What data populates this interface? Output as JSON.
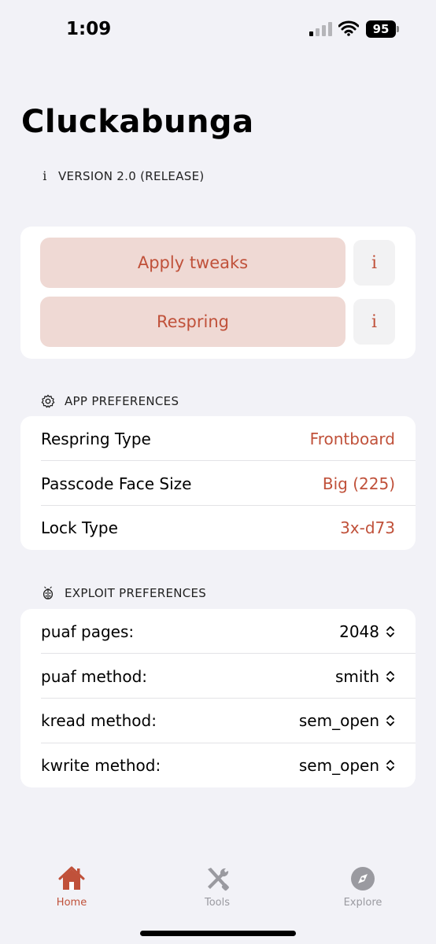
{
  "status": {
    "time": "1:09",
    "battery": "95"
  },
  "app": {
    "title": "Cluckabunga",
    "version": "VERSION 2.0 (RELEASE)"
  },
  "actions": {
    "apply_label": "Apply tweaks",
    "respring_label": "Respring",
    "info_glyph": "i"
  },
  "app_preferences": {
    "header": "APP PREFERENCES",
    "rows": [
      {
        "label": "Respring Type",
        "value": "Frontboard"
      },
      {
        "label": "Passcode Face Size",
        "value": "Big (225)"
      },
      {
        "label": "Lock Type",
        "value": "3x-d73"
      }
    ]
  },
  "exploit_preferences": {
    "header": "EXPLOIT PREFERENCES",
    "rows": [
      {
        "label": "puaf pages:",
        "value": "2048"
      },
      {
        "label": "puaf method:",
        "value": "smith"
      },
      {
        "label": "kread method:",
        "value": "sem_open"
      },
      {
        "label": "kwrite method:",
        "value": "sem_open"
      }
    ]
  },
  "tabs": [
    {
      "label": "Home",
      "icon": "house-icon",
      "active": true
    },
    {
      "label": "Tools",
      "icon": "tools-icon",
      "active": false
    },
    {
      "label": "Explore",
      "icon": "compass-icon",
      "active": false
    }
  ],
  "colors": {
    "accent": "#c0513a",
    "button_bg": "#efd9d4",
    "background": "#f2f2f7"
  }
}
